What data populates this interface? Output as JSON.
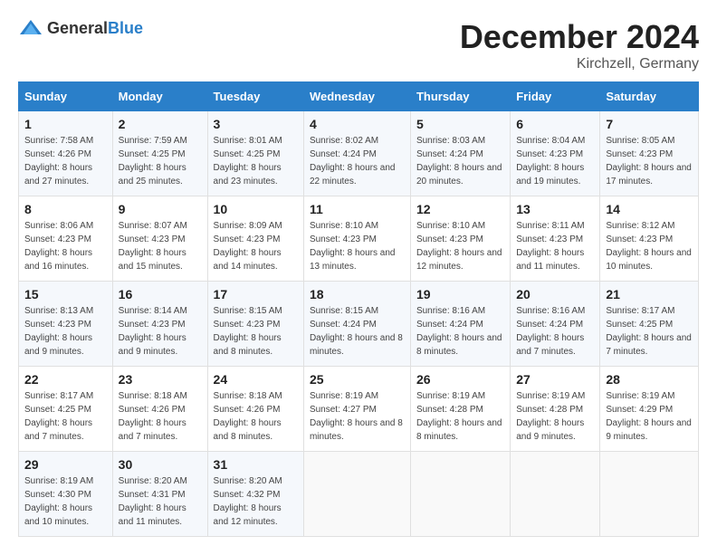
{
  "logo": {
    "text_general": "General",
    "text_blue": "Blue"
  },
  "title": "December 2024",
  "location": "Kirchzell, Germany",
  "days_of_week": [
    "Sunday",
    "Monday",
    "Tuesday",
    "Wednesday",
    "Thursday",
    "Friday",
    "Saturday"
  ],
  "weeks": [
    [
      {
        "day": "1",
        "sunrise": "7:58 AM",
        "sunset": "4:26 PM",
        "daylight": "8 hours and 27 minutes."
      },
      {
        "day": "2",
        "sunrise": "7:59 AM",
        "sunset": "4:25 PM",
        "daylight": "8 hours and 25 minutes."
      },
      {
        "day": "3",
        "sunrise": "8:01 AM",
        "sunset": "4:25 PM",
        "daylight": "8 hours and 23 minutes."
      },
      {
        "day": "4",
        "sunrise": "8:02 AM",
        "sunset": "4:24 PM",
        "daylight": "8 hours and 22 minutes."
      },
      {
        "day": "5",
        "sunrise": "8:03 AM",
        "sunset": "4:24 PM",
        "daylight": "8 hours and 20 minutes."
      },
      {
        "day": "6",
        "sunrise": "8:04 AM",
        "sunset": "4:23 PM",
        "daylight": "8 hours and 19 minutes."
      },
      {
        "day": "7",
        "sunrise": "8:05 AM",
        "sunset": "4:23 PM",
        "daylight": "8 hours and 17 minutes."
      }
    ],
    [
      {
        "day": "8",
        "sunrise": "8:06 AM",
        "sunset": "4:23 PM",
        "daylight": "8 hours and 16 minutes."
      },
      {
        "day": "9",
        "sunrise": "8:07 AM",
        "sunset": "4:23 PM",
        "daylight": "8 hours and 15 minutes."
      },
      {
        "day": "10",
        "sunrise": "8:09 AM",
        "sunset": "4:23 PM",
        "daylight": "8 hours and 14 minutes."
      },
      {
        "day": "11",
        "sunrise": "8:10 AM",
        "sunset": "4:23 PM",
        "daylight": "8 hours and 13 minutes."
      },
      {
        "day": "12",
        "sunrise": "8:10 AM",
        "sunset": "4:23 PM",
        "daylight": "8 hours and 12 minutes."
      },
      {
        "day": "13",
        "sunrise": "8:11 AM",
        "sunset": "4:23 PM",
        "daylight": "8 hours and 11 minutes."
      },
      {
        "day": "14",
        "sunrise": "8:12 AM",
        "sunset": "4:23 PM",
        "daylight": "8 hours and 10 minutes."
      }
    ],
    [
      {
        "day": "15",
        "sunrise": "8:13 AM",
        "sunset": "4:23 PM",
        "daylight": "8 hours and 9 minutes."
      },
      {
        "day": "16",
        "sunrise": "8:14 AM",
        "sunset": "4:23 PM",
        "daylight": "8 hours and 9 minutes."
      },
      {
        "day": "17",
        "sunrise": "8:15 AM",
        "sunset": "4:23 PM",
        "daylight": "8 hours and 8 minutes."
      },
      {
        "day": "18",
        "sunrise": "8:15 AM",
        "sunset": "4:24 PM",
        "daylight": "8 hours and 8 minutes."
      },
      {
        "day": "19",
        "sunrise": "8:16 AM",
        "sunset": "4:24 PM",
        "daylight": "8 hours and 8 minutes."
      },
      {
        "day": "20",
        "sunrise": "8:16 AM",
        "sunset": "4:24 PM",
        "daylight": "8 hours and 7 minutes."
      },
      {
        "day": "21",
        "sunrise": "8:17 AM",
        "sunset": "4:25 PM",
        "daylight": "8 hours and 7 minutes."
      }
    ],
    [
      {
        "day": "22",
        "sunrise": "8:17 AM",
        "sunset": "4:25 PM",
        "daylight": "8 hours and 7 minutes."
      },
      {
        "day": "23",
        "sunrise": "8:18 AM",
        "sunset": "4:26 PM",
        "daylight": "8 hours and 7 minutes."
      },
      {
        "day": "24",
        "sunrise": "8:18 AM",
        "sunset": "4:26 PM",
        "daylight": "8 hours and 8 minutes."
      },
      {
        "day": "25",
        "sunrise": "8:19 AM",
        "sunset": "4:27 PM",
        "daylight": "8 hours and 8 minutes."
      },
      {
        "day": "26",
        "sunrise": "8:19 AM",
        "sunset": "4:28 PM",
        "daylight": "8 hours and 8 minutes."
      },
      {
        "day": "27",
        "sunrise": "8:19 AM",
        "sunset": "4:28 PM",
        "daylight": "8 hours and 9 minutes."
      },
      {
        "day": "28",
        "sunrise": "8:19 AM",
        "sunset": "4:29 PM",
        "daylight": "8 hours and 9 minutes."
      }
    ],
    [
      {
        "day": "29",
        "sunrise": "8:19 AM",
        "sunset": "4:30 PM",
        "daylight": "8 hours and 10 minutes."
      },
      {
        "day": "30",
        "sunrise": "8:20 AM",
        "sunset": "4:31 PM",
        "daylight": "8 hours and 11 minutes."
      },
      {
        "day": "31",
        "sunrise": "8:20 AM",
        "sunset": "4:32 PM",
        "daylight": "8 hours and 12 minutes."
      },
      null,
      null,
      null,
      null
    ]
  ]
}
